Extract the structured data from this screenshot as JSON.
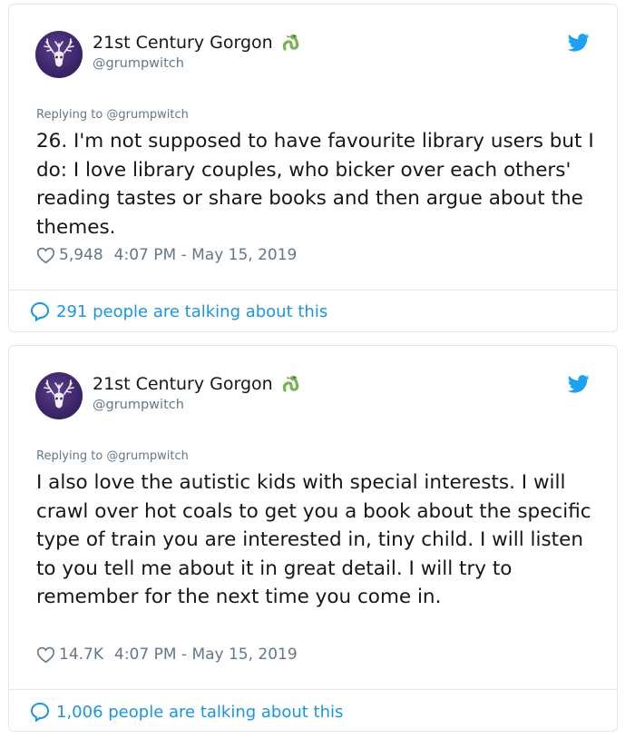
{
  "tweets": [
    {
      "display_name": "21st Century Gorgon",
      "handle": "@grumpwitch",
      "replying_to": "Replying to @grumpwitch",
      "text": "26. I'm not supposed to have favourite library users but I do: I love library couples, who bicker over each others' reading tastes or share books and then argue about the themes.",
      "likes": "5,948",
      "timestamp": "4:07 PM - May 15, 2019",
      "talking": "291 people are talking about this"
    },
    {
      "display_name": "21st Century Gorgon",
      "handle": "@grumpwitch",
      "replying_to": "Replying to @grumpwitch",
      "text": "I also love the autistic kids with special interests. I will crawl over hot coals to get you a book about the specific type of train you are interested in, tiny child. I will listen to you tell me about it in great detail. I will try to remember for the next time you come in.",
      "likes": "14.7K",
      "timestamp": "4:07 PM - May 15, 2019",
      "talking": "1,006 people are talking about this"
    }
  ],
  "icons": {
    "avatar": "deer-skull-avatar",
    "name_emoji": "snake-emoji-icon",
    "brand": "twitter-bird-icon",
    "like": "heart-icon",
    "reply": "speech-bubble-icon"
  },
  "colors": {
    "link": "#1b95e0",
    "brand": "#1da1f2",
    "muted": "#657786",
    "border": "#e1e8ed"
  }
}
